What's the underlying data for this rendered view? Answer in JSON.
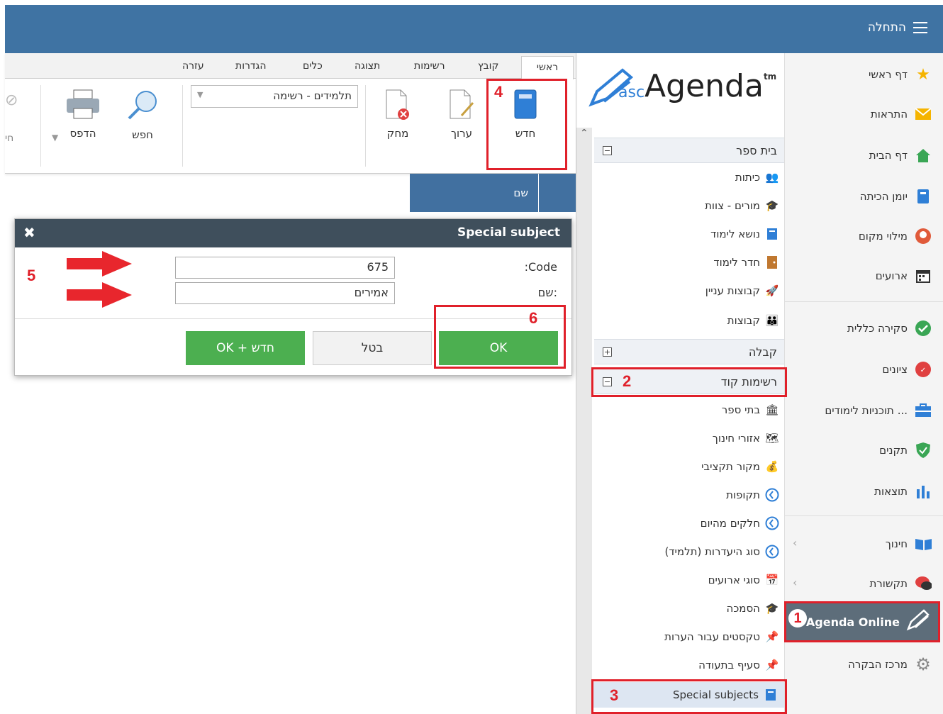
{
  "topbar": {
    "menu_label": "התחלה"
  },
  "nav": {
    "items": [
      {
        "label": "דף ראשי",
        "icon": "star-icon"
      },
      {
        "label": "התראות",
        "icon": "envelope-icon"
      },
      {
        "label": "דף הבית",
        "icon": "house-icon"
      },
      {
        "label": "יומן הכיתה",
        "icon": "book-icon"
      },
      {
        "label": "מילוי מקום",
        "icon": "substitute-icon"
      },
      {
        "label": "ארועים",
        "icon": "calendar-icon"
      },
      {
        "label": "סקירה כללית",
        "icon": "check-circle-icon"
      },
      {
        "label": "ציונים",
        "icon": "grades-icon"
      },
      {
        "label": "תוכניות לימודים ...",
        "icon": "briefcase-icon"
      },
      {
        "label": "תקנים",
        "icon": "shield-icon"
      },
      {
        "label": "תוצאות",
        "icon": "bar-chart-icon"
      },
      {
        "label": "חינוך",
        "icon": "open-book-icon"
      },
      {
        "label": "תקשורת",
        "icon": "chat-icon"
      },
      {
        "label": "מרכז הבקרה",
        "icon": "gear-icon"
      }
    ],
    "agenda_online": "Agenda Online"
  },
  "logo": {
    "prefix": "asc",
    "name": "Agenda",
    "tm": "tm"
  },
  "tree": {
    "school": "בית ספר",
    "school_items": [
      "כיתות",
      "מורים - צוות",
      "נושא לימוד",
      "חדר לימוד",
      "קבוצות עניין",
      "קבוצות"
    ],
    "reception": "קבלה",
    "codelists": "רשימות קוד",
    "codelist_items": [
      "בתי ספר",
      "אזורי חינוך",
      "מקור תקציבי",
      "תקופות",
      "חלקים מהיום",
      "סוג היעדרות (תלמיד)",
      "סוגי ארועים",
      "הסמכה",
      "טקסטים עבור הערות",
      "סעיף בתעודה",
      "Special subjects"
    ]
  },
  "ribbon": {
    "tabs": [
      "ראשי",
      "קובץ",
      "רשימות",
      "תצוגה",
      "כלים",
      "הגדרות",
      "עזרה"
    ],
    "new": "חדש",
    "edit": "ערוך",
    "delete": "מחק",
    "list_select": "תלמידים - רשימה",
    "search": "חפש",
    "print": "הדפס",
    "cut_label": "חי"
  },
  "grid": {
    "col_name": "שם"
  },
  "dialog": {
    "title": "Special subject",
    "code_label": ":Code",
    "name_label": "שם:",
    "code_value": "675",
    "name_value": "אמירים",
    "ok": "OK",
    "cancel": "בטל",
    "ok_new": "OK + חדש"
  },
  "annotations": [
    "1",
    "2",
    "3",
    "4",
    "5",
    "6"
  ],
  "colors": {
    "topbar": "#3f73a3",
    "annotation": "#e0202a",
    "ok_green": "#4caf50",
    "dialog_title": "#3f4f5c"
  }
}
